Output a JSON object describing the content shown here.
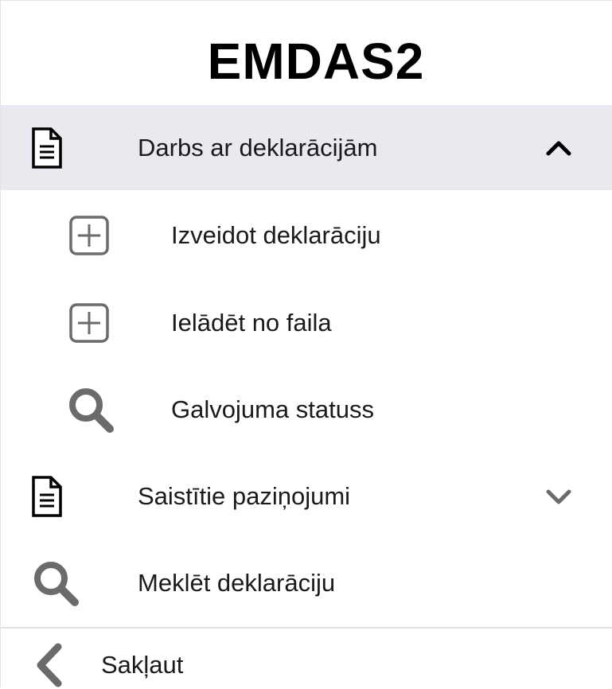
{
  "app": {
    "title": "EMDAS2"
  },
  "menu": {
    "items": [
      {
        "label": "Darbs ar deklarācijām",
        "icon": "document-icon",
        "expanded": true,
        "chevron": "chevron-up-icon",
        "children": [
          {
            "label": "Izveidot deklarāciju",
            "icon": "plus-square-icon"
          },
          {
            "label": "Ielādēt no faila",
            "icon": "plus-square-icon"
          },
          {
            "label": "Galvojuma statuss",
            "icon": "search-icon"
          }
        ]
      },
      {
        "label": "Saistītie paziņojumi",
        "icon": "document-icon",
        "expanded": false,
        "chevron": "chevron-down-icon"
      },
      {
        "label": "Meklēt deklarāciju",
        "icon": "search-icon"
      }
    ]
  },
  "footer": {
    "collapse_label": "Sakļaut",
    "icon": "chevron-left-icon"
  },
  "colors": {
    "active_background": "#e8eaf0",
    "icon_gray": "#6b6b6b",
    "text": "#1a1a1a"
  }
}
